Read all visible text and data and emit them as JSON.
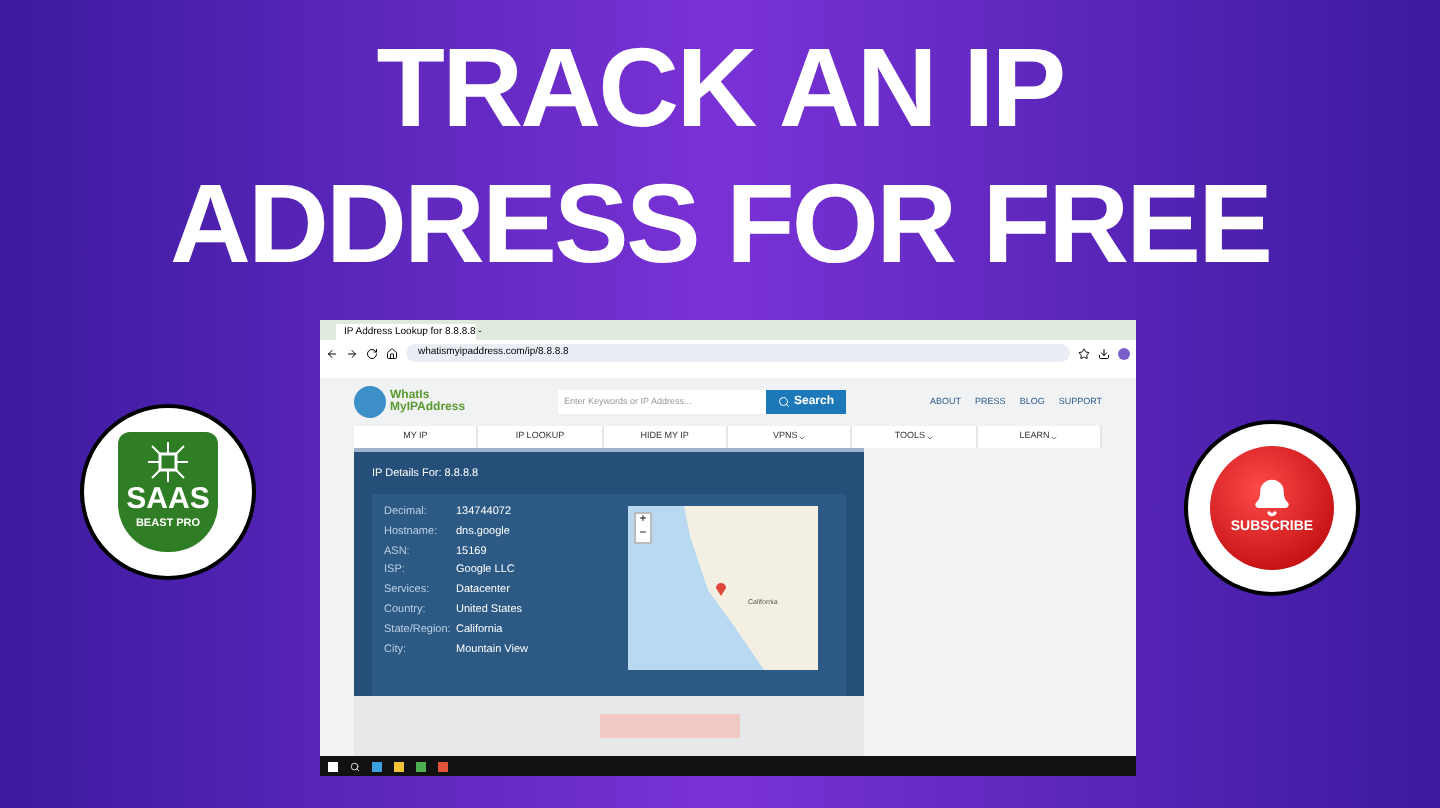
{
  "headline": [
    "TRACK AN IP",
    "ADDRESS FOR FREE"
  ],
  "left_badge": {
    "title": "SAAS",
    "subtitle": "BEAST PRO"
  },
  "right_badge": {
    "label": "SUBSCRIBE"
  },
  "browser": {
    "tab": "IP Address Lookup for 8.8.8.8 -",
    "url": "whatismyipaddress.com/ip/8.8.8.8"
  },
  "site": {
    "logo_lines": [
      "WhatIs",
      "MyIPAddress"
    ],
    "search": {
      "placeholder": "Enter Keywords or IP Address...",
      "button": "Search"
    },
    "links": [
      "ABOUT",
      "PRESS",
      "BLOG",
      "SUPPORT"
    ],
    "nav": [
      {
        "label": "MY IP",
        "dropdown": false
      },
      {
        "label": "IP LOOKUP",
        "dropdown": false
      },
      {
        "label": "HIDE MY IP",
        "dropdown": false
      },
      {
        "label": "VPNS",
        "dropdown": true
      },
      {
        "label": "TOOLS",
        "dropdown": true
      },
      {
        "label": "LEARN",
        "dropdown": true
      }
    ],
    "panel": {
      "title": "IP Details For: 8.8.8.8",
      "details": [
        {
          "label": "Decimal:",
          "value": "134744072"
        },
        {
          "label": "Hostname:",
          "value": "dns.google"
        },
        {
          "label": "ASN:",
          "value": "15169"
        },
        {
          "label": "ISP:",
          "value": "Google LLC"
        },
        {
          "label": "Services:",
          "value": "Datacenter"
        },
        {
          "label": "Country:",
          "value": "United States"
        },
        {
          "label": "State/Region:",
          "value": "California"
        },
        {
          "label": "City:",
          "value": "Mountain View"
        }
      ],
      "map": {
        "zoom_in": "+",
        "zoom_out": "−",
        "region_label": "California"
      }
    }
  }
}
